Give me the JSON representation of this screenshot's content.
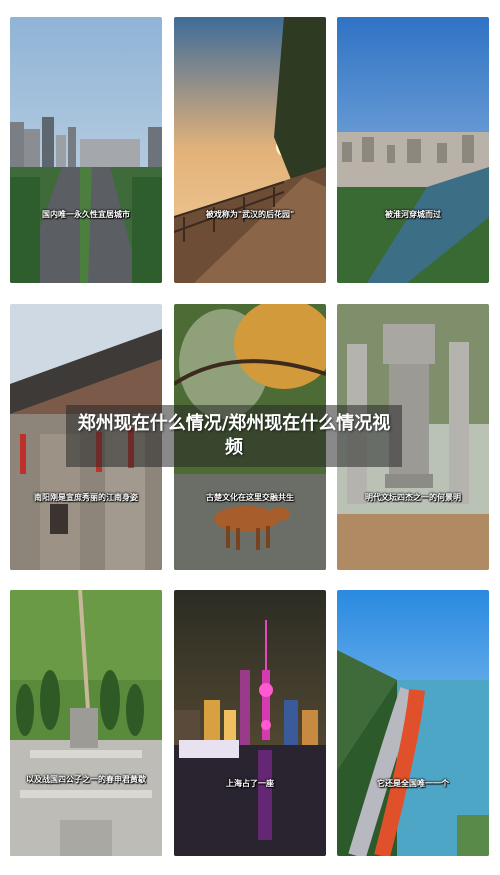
{
  "title": "郑州现在什么情况/郑州现在什么情况视频",
  "tiles": [
    {
      "caption": "国内唯一永久性宜居城市"
    },
    {
      "caption": "被戏称为\"武汉的后花园\""
    },
    {
      "caption": "被淮河穿城而过"
    },
    {
      "caption": "南阳刚是宣庶秀丽的江南身姿"
    },
    {
      "caption": "古楚文化在这里交融共生"
    },
    {
      "caption": "明代文坛四杰之一的何景明"
    },
    {
      "caption": "以及战国四公子之一的春申君黄歇"
    },
    {
      "caption": "上海占了一座"
    },
    {
      "caption": "它还是全国唯一一个"
    }
  ]
}
